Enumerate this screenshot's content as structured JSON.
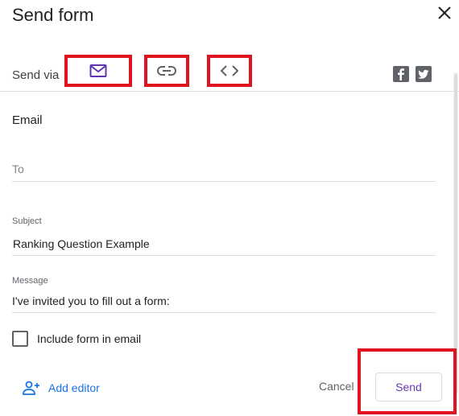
{
  "dialog": {
    "title": "Send form"
  },
  "send_via": {
    "label": "Send via",
    "tabs": [
      {
        "id": "email",
        "icon": "mail-icon",
        "active": true
      },
      {
        "id": "link",
        "icon": "link-icon",
        "active": false
      },
      {
        "id": "embed",
        "icon": "code-embed-icon",
        "active": false
      }
    ],
    "social": [
      "facebook-icon",
      "twitter-icon"
    ]
  },
  "email": {
    "section_title": "Email",
    "to_placeholder": "To",
    "subject_label": "Subject",
    "subject_value": "Ranking Question Example",
    "message_label": "Message",
    "message_value": "I've invited you to fill out a form:",
    "include_form_label": "Include form in email",
    "include_form_checked": false
  },
  "footer": {
    "add_editor_label": "Add editor",
    "cancel_label": "Cancel",
    "send_label": "Send"
  },
  "colors": {
    "accent_purple": "#673ab7",
    "link_blue": "#1a73e8",
    "highlight_red": "#e0141e"
  }
}
